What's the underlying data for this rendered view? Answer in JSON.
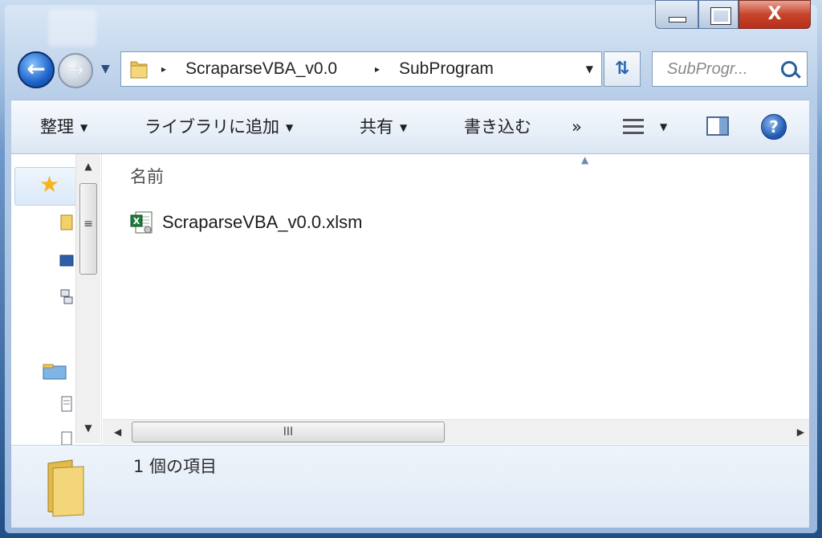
{
  "window": {
    "caption_buttons": {
      "minimize_icon": "minimize-icon",
      "maximize_icon": "maximize-icon",
      "close_label": "X"
    }
  },
  "navigation": {
    "back_icon": "back-arrow-icon",
    "forward_icon": "forward-arrow-icon",
    "history_dropdown_icon": "chevron-down-icon",
    "address": {
      "crumbs": [
        "ScraparseVBA_v0.0",
        "SubProgram"
      ],
      "separator": "▸",
      "dropdown_icon": "chevron-down-icon"
    },
    "refresh_icon": "refresh-icon",
    "search": {
      "placeholder": "SubProgr..."
    }
  },
  "toolbar": {
    "organize": "整理",
    "add_to_library": "ライブラリに追加",
    "share": "共有",
    "burn": "書き込む",
    "more": "»",
    "view_icon": "details-view-icon",
    "preview_pane_icon": "preview-pane-icon",
    "help": "?"
  },
  "nav_pane": {
    "favorites_icon": "star-icon"
  },
  "file_list": {
    "column_header": "名前",
    "files": [
      {
        "name": "ScraparseVBA_v0.0.xlsm",
        "icon": "excel-macro-file-icon"
      }
    ],
    "hscroll_grip": "III",
    "vscroll_grip": "≡"
  },
  "details_pane": {
    "item_count": "1 個の項目",
    "icon": "folder-icon"
  }
}
